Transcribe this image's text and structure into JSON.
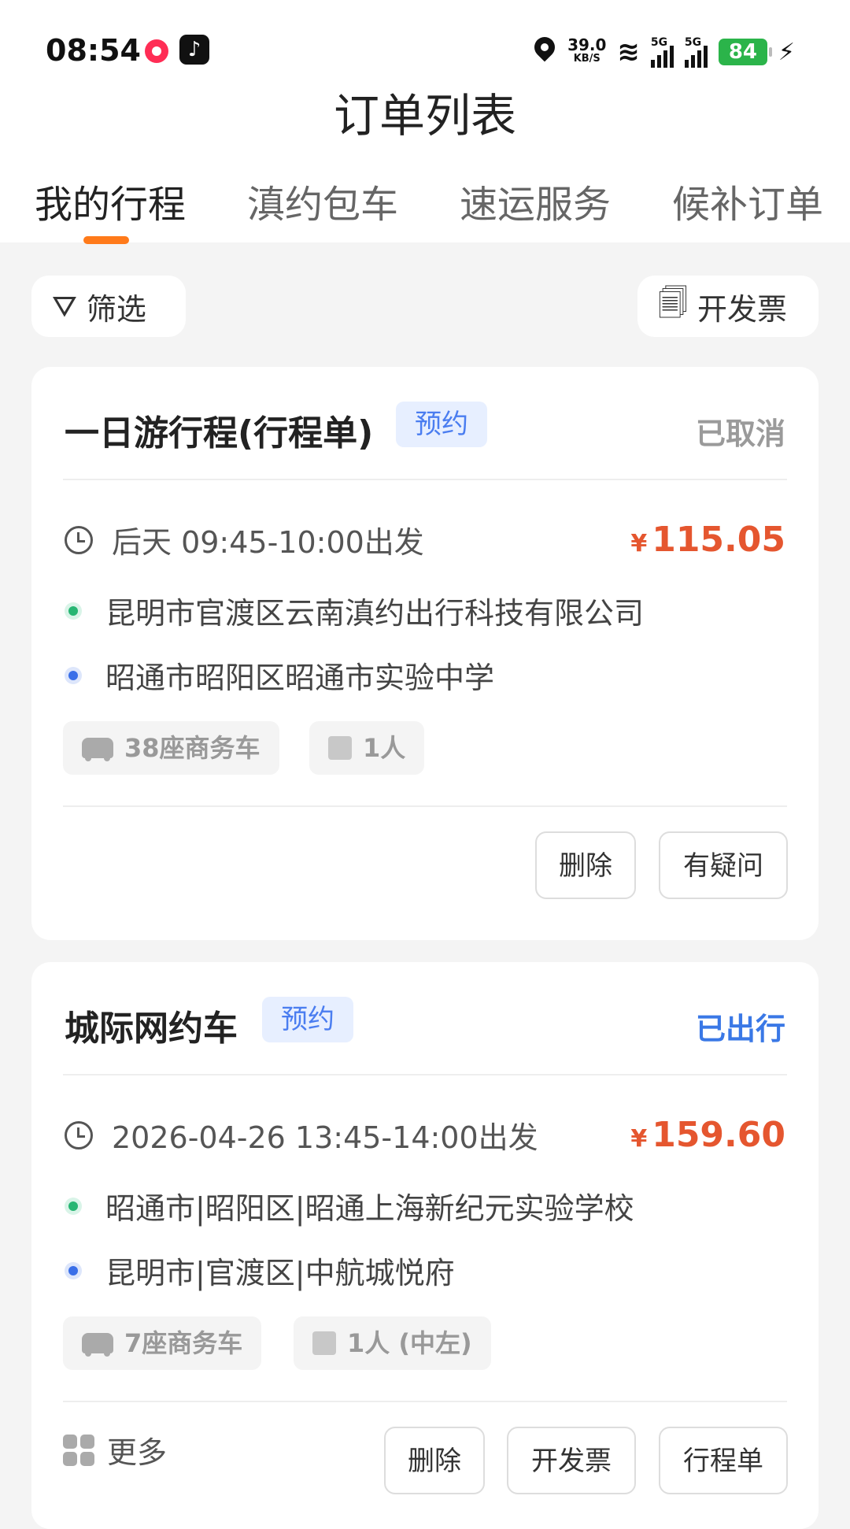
{
  "status_bar": {
    "time": "08:54",
    "net_speed_value": "39.0",
    "net_speed_unit": "KB/S",
    "signal1_label": "5G",
    "signal2_label": "5G",
    "battery": "84"
  },
  "header": {
    "title": "订单列表"
  },
  "tabs": [
    {
      "label": "我的行程",
      "active": true
    },
    {
      "label": "滇约包车",
      "active": false
    },
    {
      "label": "速运服务",
      "active": false
    },
    {
      "label": "候补订单",
      "active": false
    }
  ],
  "toolbar": {
    "filter_label": "筛选",
    "invoice_label": "开发票"
  },
  "orders": [
    {
      "title": "一日游行程(行程单)",
      "tag": "预约",
      "status": "已取消",
      "status_color": "#9a9a9a",
      "time": "后天 09:45-10:00出发",
      "currency": "¥",
      "price": "115.05",
      "start": "昆明市官渡区云南滇约出行科技有限公司",
      "end": "昭通市昭阳区昭通市实验中学",
      "vehicle": "38座商务车",
      "passengers": "1人",
      "actions": [
        "删除",
        "有疑问"
      ]
    },
    {
      "title": "城际网约车",
      "tag": "预约",
      "status": "已出行",
      "status_color": "#3a78e6",
      "time": "2026-04-26 13:45-14:00出发",
      "currency": "¥",
      "price": "159.60",
      "start": "昭通市|昭阳区|昭通上海新纪元实验学校",
      "end": "昆明市|官渡区|中航城悦府",
      "vehicle": "7座商务车",
      "passengers": "1人 (中左)",
      "more_label": "更多",
      "actions": [
        "删除",
        "开发票",
        "行程单"
      ]
    }
  ]
}
